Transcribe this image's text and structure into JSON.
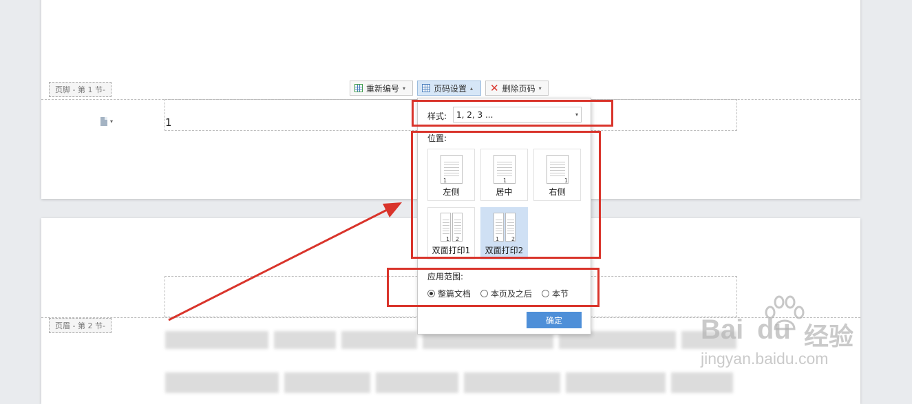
{
  "footer_tag": "页脚 - 第 1 节-",
  "header_tag": "页眉 - 第 2 节-",
  "page_number_value": "1",
  "toolbar": {
    "renumber_label": "重新编号",
    "page_settings_label": "页码设置",
    "delete_label": "删除页码"
  },
  "dropdown": {
    "style_label": "样式:",
    "style_value": "1, 2, 3 ...",
    "position_label": "位置:",
    "positions": [
      {
        "label": "左侧"
      },
      {
        "label": "居中"
      },
      {
        "label": "右侧"
      },
      {
        "label": "双面打印1"
      },
      {
        "label": "双面打印2",
        "selected": true
      }
    ],
    "scope_label": "应用范围:",
    "scope_options": [
      {
        "label": "整篇文档",
        "checked": true
      },
      {
        "label": "本页及之后",
        "checked": false
      },
      {
        "label": "本节",
        "checked": false
      }
    ],
    "ok_label": "确定"
  },
  "watermark": {
    "brand": "Bai",
    "brand2": "du",
    "cn": "经验",
    "url": "jingyan.baidu.com"
  },
  "colors": {
    "accent": "#4e8fd8",
    "annotation_red": "#d9342b",
    "selected_bg": "#cfe0f4"
  }
}
